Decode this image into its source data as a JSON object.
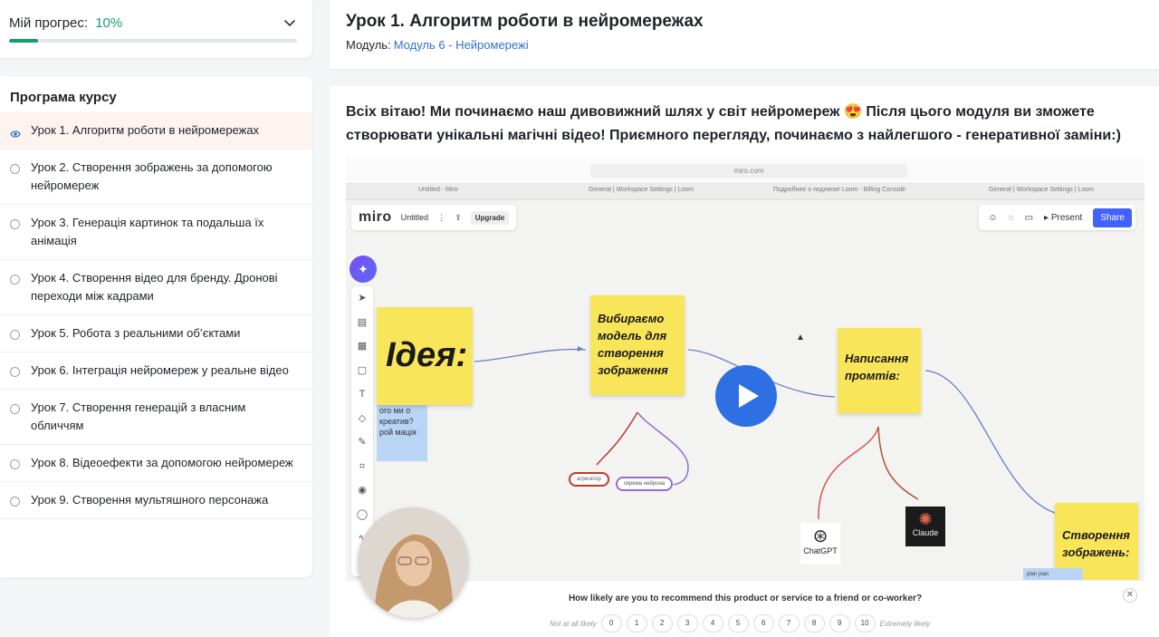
{
  "progress": {
    "label": "Мій прогрес:",
    "percent_text": "10%",
    "percent": 10,
    "accent": "#1c9a6b"
  },
  "program": {
    "title": "Програма курсу",
    "lessons": [
      {
        "label": "Урок 1. Алгоритм роботи в нейромережах",
        "active": true
      },
      {
        "label": "Урок 2. Створення зображень за допомогою нейромереж"
      },
      {
        "label": "Урок 3. Генерація картинок та подальша їх анімація"
      },
      {
        "label": "Урок 4. Створення відео для бренду. Дронові переходи між кадрами"
      },
      {
        "label": "Урок 5. Робота з реальними об’єктами"
      },
      {
        "label": "Урок 6. Інтеграція нейромереж у реальне відео"
      },
      {
        "label": "Урок 7. Створення генерацій з власним обличчям"
      },
      {
        "label": "Урок 8. Відеоефекти за допомогою нейромереж"
      },
      {
        "label": "Урок 9. Створення мультяшного персонажа"
      }
    ]
  },
  "header": {
    "title": "Урок 1. Алгоритм роботи в нейромережах",
    "module_label": "Модуль:",
    "module_link": "Модуль 6 - Нейромережі",
    "link_color": "#2f6fd6"
  },
  "content": {
    "intro": "Всіх вітаю! Ми починаємо наш дивовижний шлях у світ нейромереж 😍 Після цього модуля ви зможете створювати унікальні магічні відео! Приємного перегляду, починаємо з найлегшого - генеративної заміни:)"
  },
  "video": {
    "url": "miro.com",
    "tabs": [
      "Untitled - Miro",
      "General | Workspace Settings | Loom",
      "Подробнее о подписке Loom - Billing Console",
      "General | Workspace Settings | Loom"
    ],
    "miro": {
      "logo": "miro",
      "board": "Untitled",
      "upgrade": "Upgrade",
      "present": "Present",
      "share": "Share"
    },
    "stickies": {
      "idea": "Ідея:",
      "model": "Вибираємо модель для створення зображення",
      "prompt": "Написання промтів:",
      "create": "Створення зображень:"
    },
    "blue_note": "ого ми о креатив? ого ми о креатив? рой мація",
    "blue_note2": "plan plan",
    "pills": [
      "агрегатор",
      "окрема нейрона"
    ],
    "logos": [
      "ChatGPT",
      "Claude"
    ],
    "survey": {
      "question": "How likely are you to recommend this product or service to a friend or co-worker?",
      "low": "Not at all likely",
      "high": "Extremely likely",
      "scale": [
        "0",
        "1",
        "2",
        "3",
        "4",
        "5",
        "6",
        "7",
        "8",
        "9",
        "10"
      ]
    }
  }
}
